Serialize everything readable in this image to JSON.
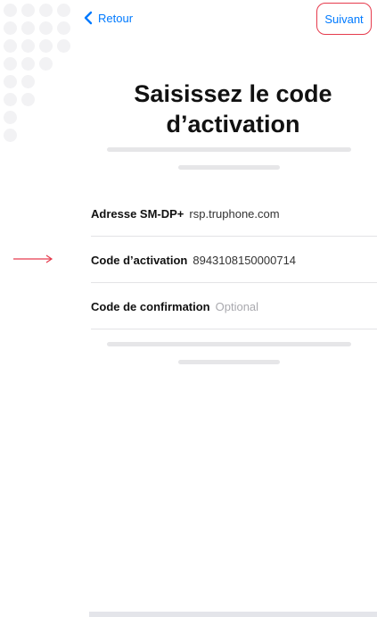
{
  "nav": {
    "back_label": "Retour",
    "next_label": "Suivant"
  },
  "page": {
    "title_line1": "Saisissez le code",
    "title_line2": "d’activation"
  },
  "fields": [
    {
      "label": "Adresse SM-DP+",
      "value": "rsp.truphone.com"
    },
    {
      "label": "Code d’activation",
      "value": "8943108150000714"
    },
    {
      "label": "Code de confirmation",
      "placeholder": "Optional"
    }
  ],
  "colors": {
    "accent": "#007aff",
    "highlight": "#e63b4d"
  },
  "icons": {
    "back": "chevron-left-icon",
    "annotation": "arrow-right-icon"
  }
}
